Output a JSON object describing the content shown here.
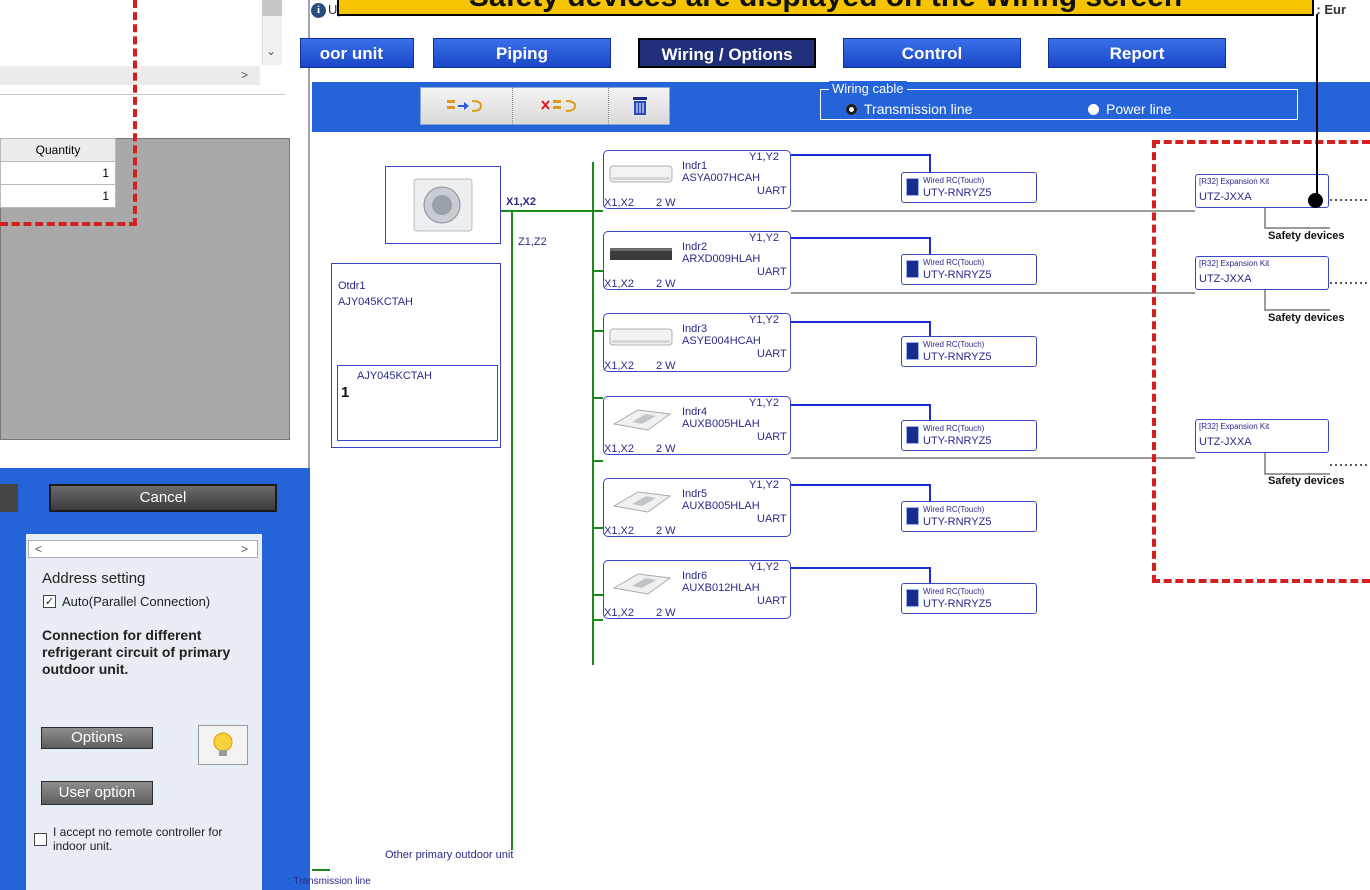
{
  "header": {
    "update_label": "Update",
    "update_icon": "info-icon",
    "district_label": "District : Eur",
    "banner_text": "Safety devices are displayed on the Wiring screen",
    "tabs": [
      {
        "label": "oor unit",
        "active": false
      },
      {
        "label": "Piping",
        "active": false
      },
      {
        "label": "Wiring / Options",
        "active": true
      },
      {
        "label": "Control",
        "active": false
      },
      {
        "label": "Report",
        "active": false
      }
    ]
  },
  "toolbar": {
    "buttons": [
      "connect-wiring-icon",
      "delete-wiring-icon",
      "trash-icon"
    ],
    "wiring_cable": {
      "legend": "Wiring cable",
      "options": [
        {
          "label": "Transmission line",
          "selected": true
        },
        {
          "label": "Power line",
          "selected": false
        }
      ]
    }
  },
  "dialog": {
    "table": {
      "header": "Quantity",
      "rows": [
        "1",
        "1"
      ]
    },
    "cancel_label": "Cancel"
  },
  "side_panel": {
    "address_title": "Address setting",
    "auto_label": "Auto(Parallel Connection)",
    "auto_checked": true,
    "connection_text": "Connection for different refrigerant circuit of primary outdoor unit.",
    "options_label": "Options",
    "user_option_label": "User option",
    "accept_label": "I accept no remote controller for indoor unit.",
    "accept_checked": false
  },
  "diagram": {
    "outdoor": {
      "terminal_main": "X1,X2",
      "terminal_secondary": "Z1,Z2",
      "name": "Otdr1",
      "model": "AJY045KCTAH",
      "inner_model": "AJY045KCTAH",
      "inner_number": "1"
    },
    "indoor_units": [
      {
        "name": "Indr1",
        "model": "ASYA007HCAH",
        "terminal_top": "Y1,Y2",
        "uart": "UART",
        "terminal": "X1,X2",
        "wires": "2 W",
        "img": "wall"
      },
      {
        "name": "Indr2",
        "model": "ARXD009HLAH",
        "terminal_top": "Y1,Y2",
        "uart": "UART",
        "terminal": "X1,X2",
        "wires": "2 W",
        "img": "duct"
      },
      {
        "name": "Indr3",
        "model": "ASYE004HCAH",
        "terminal_top": "Y1,Y2",
        "uart": "UART",
        "terminal": "X1,X2",
        "wires": "2 W",
        "img": "wall"
      },
      {
        "name": "Indr4",
        "model": "AUXB005HLAH",
        "terminal_top": "Y1,Y2",
        "uart": "UART",
        "terminal": "X1,X2",
        "wires": "2 W",
        "img": "cassette"
      },
      {
        "name": "Indr5",
        "model": "AUXB005HLAH",
        "terminal_top": "Y1,Y2",
        "uart": "UART",
        "terminal": "X1,X2",
        "wires": "2 W",
        "img": "cassette"
      },
      {
        "name": "Indr6",
        "model": "AUXB012HLAH",
        "terminal_top": "Y1,Y2",
        "uart": "UART",
        "terminal": "X1,X2",
        "wires": "2 W",
        "img": "cassette"
      }
    ],
    "remote_controller": {
      "title": "Wired RC(Touch)",
      "model": "UTY-RNRYZ5"
    },
    "expansion_kit": {
      "title": "[R32] Expansion Kit",
      "model": "UTZ-JXXA"
    },
    "safety_label": "Safety devices",
    "other_outdoor_label": "Other primary outdoor unit",
    "legend_label": ": Transmission line",
    "colors": {
      "transmission": "#1a8a1a",
      "control": "#1a2cd4",
      "expansion": "#7a7a7a"
    }
  }
}
